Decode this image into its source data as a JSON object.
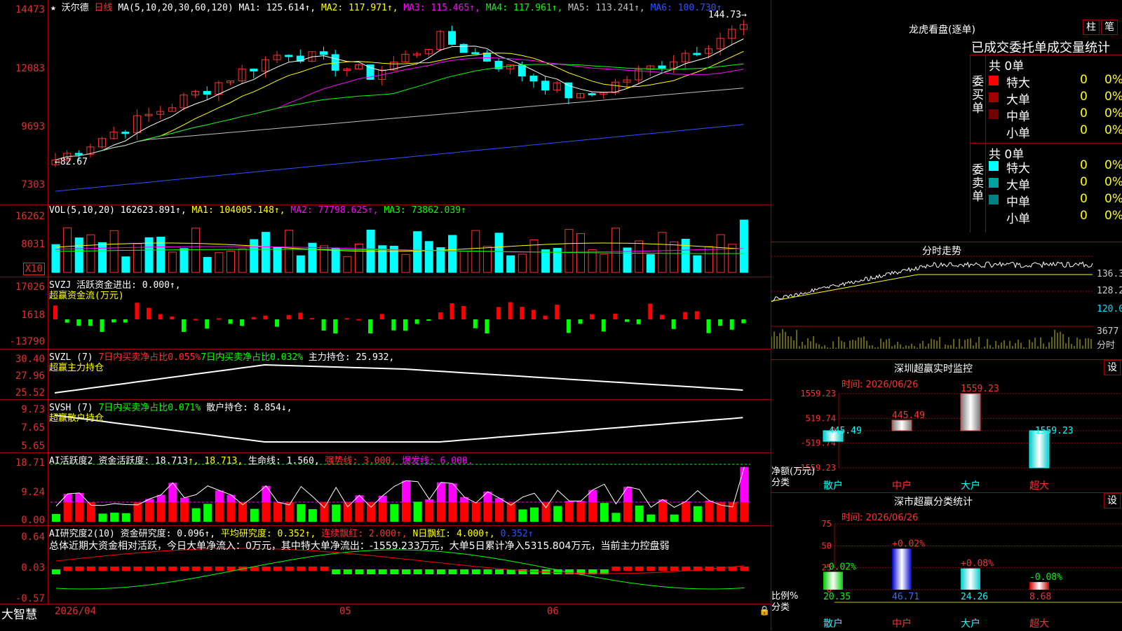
{
  "main": {
    "stock_name": "沃尔德",
    "period": "日线",
    "ma_label": "MA(5,10,20,30,60,120)",
    "ma_values": [
      {
        "label": "MA1: 125.614↑,",
        "color": "#ffffff"
      },
      {
        "label": "MA2: 117.971↑,",
        "color": "#ffff00"
      },
      {
        "label": "MA3: 115.465↑,",
        "color": "#ff00ff"
      },
      {
        "label": "MA4: 117.961↑,",
        "color": "#00ff00"
      },
      {
        "label": "MA5: 113.241↑,",
        "color": "#c0c0c0"
      },
      {
        "label": "MA6: 100.730↑",
        "color": "#3050ff"
      }
    ],
    "ticks": [
      "14473",
      "12083",
      "9693",
      "7303"
    ],
    "high_note": "144.73→",
    "low_note": "←82.67"
  },
  "vol": {
    "header": "VOL(5,10,20)",
    "values": [
      {
        "label": "162623.891↑,",
        "color": "#ffffff"
      },
      {
        "label": "MA1: 104005.148↑,",
        "color": "#ffff00"
      },
      {
        "label": "MA2: 77798.625↑,",
        "color": "#ff00ff"
      },
      {
        "label": "MA3: 73862.039↑",
        "color": "#00ff00"
      }
    ],
    "ticks": [
      "16262",
      "8031"
    ],
    "unit": "X10"
  },
  "svzj": {
    "header": "SVZJ  活跃资金进出: 0.000↑,",
    "subtitle": "超赢资金流(万元)",
    "ticks": [
      "17026",
      "1618",
      "-13790"
    ]
  },
  "svzl": {
    "header_a": "SVZL (7)",
    "header_b": "7日内买卖净占比0.055%",
    "header_c": "7日内买卖净占比0.032%",
    "header_d": "主力持仓: 25.932,",
    "subtitle": "超赢主力持仓",
    "ticks": [
      "30.40",
      "27.96",
      "25.52"
    ]
  },
  "svsh": {
    "header_a": "SVSH (7)",
    "header_b": "7日内买卖净占比0.071%",
    "header_c": "散户持仓: 8.854↓,",
    "subtitle": "超赢散户持仓",
    "ticks": [
      "9.73",
      "7.65",
      "5.65"
    ]
  },
  "ai1": {
    "header_a": "AI活跃度2",
    "header_b": "资金活跃度: 18.713",
    "header_c": "↑, 18.713,",
    "header_d": "生命线: 1.560,",
    "header_e": "强势线: 3.000,",
    "header_f": "爆发线: 6.000,",
    "ticks": [
      "18.71",
      "9.24",
      "0.00"
    ]
  },
  "ai2": {
    "header_a": "AI研究度2(10)",
    "header_b": "资金研究度: 0.096↑,",
    "header_c": "平均研究度: 0.352↑,",
    "header_d": "连续飘红: 2.000↑,",
    "header_e": "N日飘红: 4.000↑,",
    "header_f": "0.352↑",
    "summary": "总体近期大资金相对活跃，今日大单净流入：0万元，其中特大单净流出：-1559.233万元，大单5日累计净入5315.804万元，当前主力控盘弱",
    "ticks": [
      "0.64",
      "0.03",
      "-0.57"
    ]
  },
  "footer": {
    "brand": "大智慧",
    "date_start": "2026/04",
    "month_05": "05",
    "month_06": "06"
  },
  "dragon": {
    "title": "龙虎看盘(逐单)",
    "btn_bar": "柱",
    "btn_pen": "笔",
    "tabs_line": "已成交委托单成交量统计",
    "buy_label": "委买单",
    "sell_label": "委卖单",
    "buy_total": "共 0单",
    "sell_total": "共 0单",
    "buy_rows": [
      {
        "name": "特大",
        "count": "0",
        "pct": "0%",
        "color": "#ff0000"
      },
      {
        "name": "大单",
        "count": "0",
        "pct": "0%",
        "color": "#a00000"
      },
      {
        "name": "中单",
        "count": "0",
        "pct": "0%",
        "color": "#700000"
      },
      {
        "name": "小单",
        "count": "0",
        "pct": "0%",
        "color": ""
      }
    ],
    "sell_rows": [
      {
        "name": "特大",
        "count": "0",
        "pct": "0%",
        "color": "#00ffff"
      },
      {
        "name": "大单",
        "count": "0",
        "pct": "0%",
        "color": "#00a0a0"
      },
      {
        "name": "中单",
        "count": "0",
        "pct": "0%",
        "color": "#008080"
      },
      {
        "name": "小单",
        "count": "0",
        "pct": "0%",
        "color": ""
      }
    ]
  },
  "intraday": {
    "title": "分时走势",
    "ticks": [
      "136.3",
      "128.2",
      "120.0"
    ],
    "vol_tick": "3677",
    "vol_label": "分时"
  },
  "sz_monitor": {
    "title": "深圳超赢实时监控",
    "btn": "设",
    "time": "时间: 2026/06/26",
    "ticks": [
      "1559.23",
      "519.74",
      "0",
      "-519.74",
      "-1559.23"
    ],
    "unit_a": "净额(万元)",
    "unit_b": "分类",
    "categories": [
      "散户",
      "中户",
      "大户",
      "超大"
    ],
    "chart_data": {
      "type": "bar",
      "categories": [
        "散户",
        "中户",
        "大户",
        "超大"
      ],
      "values": [
        -445.49,
        445.49,
        1559.23,
        -1559.23
      ],
      "value_labels": [
        "-445.49",
        "445.49",
        "1559.23",
        "-1559.23"
      ],
      "ylim": [
        -1559.23,
        1559.23
      ]
    }
  },
  "sz_class": {
    "title": "深市超赢分类统计",
    "btn": "设",
    "time": "时间: 2026/06/26",
    "ticks": [
      "75",
      "50",
      "25",
      "0"
    ],
    "unit_a": "比例%",
    "unit_b": "分类",
    "categories": [
      "散户",
      "中户",
      "大户",
      "超大"
    ],
    "chart_data": {
      "type": "bar",
      "categories": [
        "散户",
        "中户",
        "大户",
        "超大"
      ],
      "values": [
        20.35,
        46.71,
        24.26,
        8.68
      ],
      "change_labels": [
        "-0.02%",
        "+0.02%",
        "+0.08%",
        "-0.08%"
      ],
      "value_labels": [
        "20.35",
        "46.71",
        "24.26",
        "8.68"
      ],
      "ylim": [
        0,
        75
      ]
    }
  }
}
